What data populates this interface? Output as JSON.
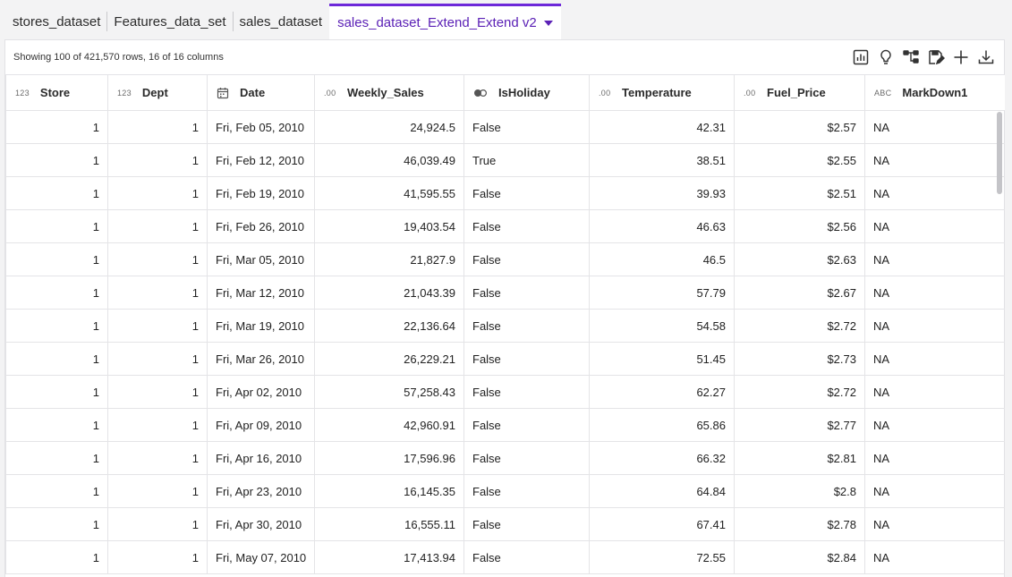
{
  "tabs": [
    {
      "label": "stores_dataset",
      "active": false
    },
    {
      "label": "Features_data_set",
      "active": false
    },
    {
      "label": "sales_dataset",
      "active": false
    },
    {
      "label": "sales_dataset_Extend_Extend v2",
      "active": true
    }
  ],
  "info": "Showing 100 of 421,570 rows, 16 of 16 columns",
  "toolbar": {
    "icons": [
      "chart-icon",
      "lightbulb-icon",
      "flow-icon",
      "save-edit-icon",
      "add-icon",
      "download-icon"
    ]
  },
  "columns": [
    {
      "label": "Store",
      "type": "123",
      "align": "num"
    },
    {
      "label": "Dept",
      "type": "123",
      "align": "num"
    },
    {
      "label": "Date",
      "type": "date",
      "align": "txt"
    },
    {
      "label": "Weekly_Sales",
      "type": ".00",
      "align": "num"
    },
    {
      "label": "IsHoliday",
      "type": "bool",
      "align": "txt"
    },
    {
      "label": "Temperature",
      "type": ".00",
      "align": "num"
    },
    {
      "label": "Fuel_Price",
      "type": ".00",
      "align": "num"
    },
    {
      "label": "MarkDown1",
      "type": "ABC",
      "align": "txt"
    }
  ],
  "rows": [
    [
      "1",
      "1",
      "Fri, Feb 05, 2010",
      "24,924.5",
      "False",
      "42.31",
      "$2.57",
      "NA"
    ],
    [
      "1",
      "1",
      "Fri, Feb 12, 2010",
      "46,039.49",
      "True",
      "38.51",
      "$2.55",
      "NA"
    ],
    [
      "1",
      "1",
      "Fri, Feb 19, 2010",
      "41,595.55",
      "False",
      "39.93",
      "$2.51",
      "NA"
    ],
    [
      "1",
      "1",
      "Fri, Feb 26, 2010",
      "19,403.54",
      "False",
      "46.63",
      "$2.56",
      "NA"
    ],
    [
      "1",
      "1",
      "Fri, Mar 05, 2010",
      "21,827.9",
      "False",
      "46.5",
      "$2.63",
      "NA"
    ],
    [
      "1",
      "1",
      "Fri, Mar 12, 2010",
      "21,043.39",
      "False",
      "57.79",
      "$2.67",
      "NA"
    ],
    [
      "1",
      "1",
      "Fri, Mar 19, 2010",
      "22,136.64",
      "False",
      "54.58",
      "$2.72",
      "NA"
    ],
    [
      "1",
      "1",
      "Fri, Mar 26, 2010",
      "26,229.21",
      "False",
      "51.45",
      "$2.73",
      "NA"
    ],
    [
      "1",
      "1",
      "Fri, Apr 02, 2010",
      "57,258.43",
      "False",
      "62.27",
      "$2.72",
      "NA"
    ],
    [
      "1",
      "1",
      "Fri, Apr 09, 2010",
      "42,960.91",
      "False",
      "65.86",
      "$2.77",
      "NA"
    ],
    [
      "1",
      "1",
      "Fri, Apr 16, 2010",
      "17,596.96",
      "False",
      "66.32",
      "$2.81",
      "NA"
    ],
    [
      "1",
      "1",
      "Fri, Apr 23, 2010",
      "16,145.35",
      "False",
      "64.84",
      "$2.8",
      "NA"
    ],
    [
      "1",
      "1",
      "Fri, Apr 30, 2010",
      "16,555.11",
      "False",
      "67.41",
      "$2.78",
      "NA"
    ],
    [
      "1",
      "1",
      "Fri, May 07, 2010",
      "17,413.94",
      "False",
      "72.55",
      "$2.84",
      "NA"
    ]
  ],
  "colors": {
    "accent": "#6d28d9",
    "accent_text": "#5b21b6"
  }
}
